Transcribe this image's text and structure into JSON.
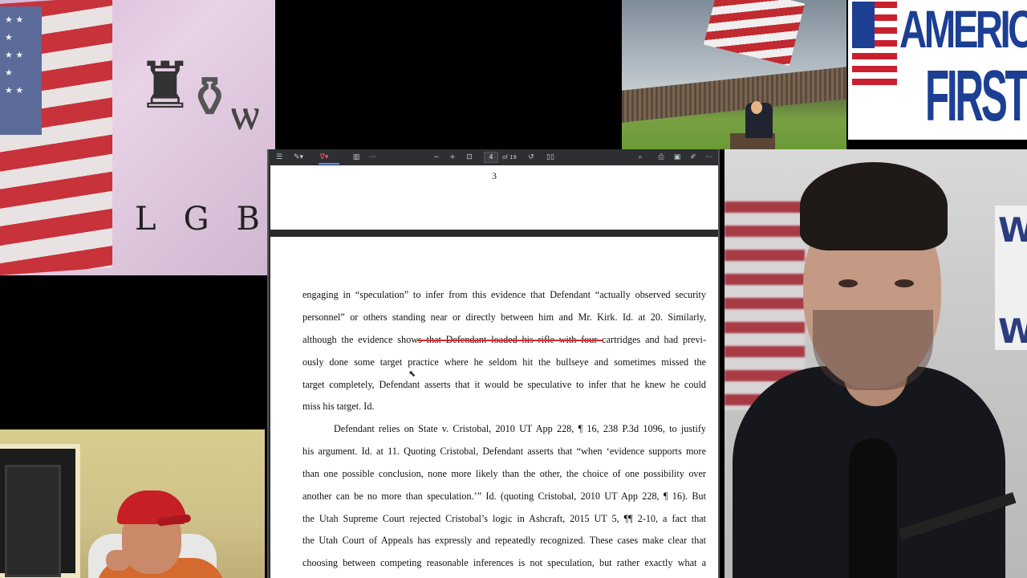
{
  "tiles": {
    "flag_tile": {
      "lgbt_text": "LGBT"
    },
    "america_first": {
      "line1": "AMERICA",
      "line2": "FIRST"
    }
  },
  "pdf": {
    "toolbar": {
      "current_page": "4",
      "page_total": "of 19",
      "icons": [
        "sidebar-icon",
        "highlight-icon",
        "draw-icon",
        "text-box-icon",
        "more-icon",
        "zoom-out-icon",
        "zoom-in-icon",
        "fit-page-icon",
        "rotate-icon",
        "two-page-icon",
        "search-icon",
        "print-icon",
        "save-icon",
        "edit-icon",
        "more-options-icon"
      ],
      "accent_color": "#ff5a6e"
    },
    "page_top_number": "3",
    "paragraphs": [
      {
        "lines": [
          "engaging in “speculation” to infer from this evidence that Defendant “actually observed security",
          "personnel” or others standing near or directly between him and Mr. Kirk. Id. at 20. Similarly,",
          "although the evidence shows that Defendant loaded his rifle with four cartridges and had previ-",
          "ously done some target practice where he seldom hit the bullseye and sometimes missed the",
          "target completely, Defendant asserts that it would be speculative to infer that he knew he could",
          "miss his target. Id."
        ]
      },
      {
        "lines": [
          "Defendant relies on State v. Cristobal, 2010 UT App 228, ¶ 16, 238 P.3d 1096, to justify",
          "his argument. Id. at 11. Quoting Cristobal, Defendant asserts that “when ‘evidence supports more",
          "than one possible conclusion, none more likely than the other, the choice of one possibility over",
          "another can be no more than speculation.’” Id. (quoting Cristobal, 2010 UT App 228, ¶ 16). But",
          "the Utah Supreme Court rejected Cristobal’s logic in Ashcraft, 2015 UT 5, ¶¶ 2-10, a fact that",
          "the Utah Court of Appeals has expressly and repeatedly recognized. These cases make clear that",
          "choosing between competing reasonable inferences is not speculation, but rather exactly what a"
        ]
      }
    ],
    "highlight_color": "#e0272f"
  }
}
